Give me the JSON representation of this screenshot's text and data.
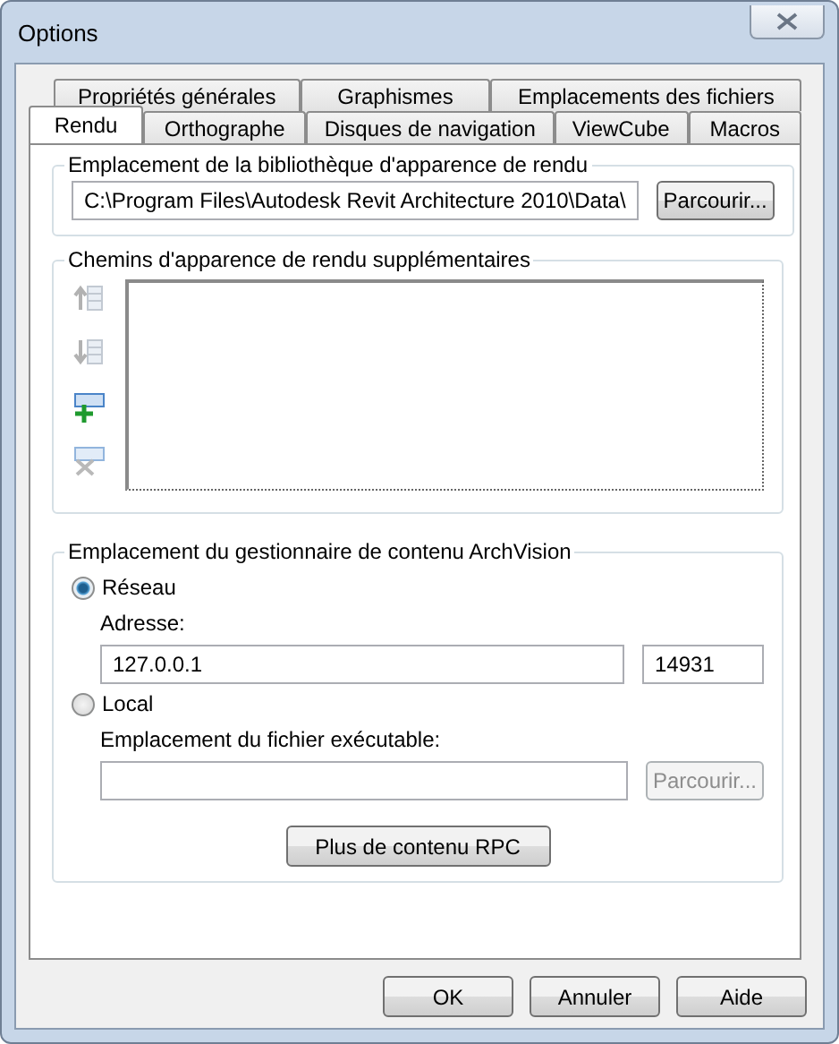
{
  "window": {
    "title": "Options"
  },
  "tab_rows": [
    [
      {
        "label": "Propriétés générales",
        "selected": false
      },
      {
        "label": "Graphismes",
        "selected": false
      },
      {
        "label": "Emplacements des fichiers",
        "selected": false
      }
    ],
    [
      {
        "label": "Rendu",
        "selected": true
      },
      {
        "label": "Orthographe",
        "selected": false
      },
      {
        "label": "Disques de navigation",
        "selected": false
      },
      {
        "label": "ViewCube",
        "selected": false
      },
      {
        "label": "Macros",
        "selected": false
      }
    ]
  ],
  "library_group": {
    "title": "Emplacement de la bibliothèque d'apparence de rendu",
    "path": "C:\\Program Files\\Autodesk Revit Architecture 2010\\Data\\",
    "browse": "Parcourir..."
  },
  "paths_group": {
    "title": "Chemins d'apparence de rendu supplémentaires",
    "tools": [
      {
        "kind": "up",
        "disabled": true
      },
      {
        "kind": "down",
        "disabled": true
      },
      {
        "kind": "add",
        "disabled": false
      },
      {
        "kind": "remove",
        "disabled": true
      }
    ]
  },
  "archvision_group": {
    "title": "Emplacement du gestionnaire de contenu ArchVision",
    "network": {
      "label": "Réseau",
      "selected": true,
      "address_label": "Adresse:",
      "address": "127.0.0.1",
      "port": "14931"
    },
    "local": {
      "label": "Local",
      "selected": false,
      "exe_label": "Emplacement du fichier exécutable:",
      "browse": "Parcourir...",
      "browse_disabled": true
    },
    "more_button": "Plus de contenu RPC"
  },
  "buttons": [
    "OK",
    "Annuler",
    "Aide"
  ]
}
